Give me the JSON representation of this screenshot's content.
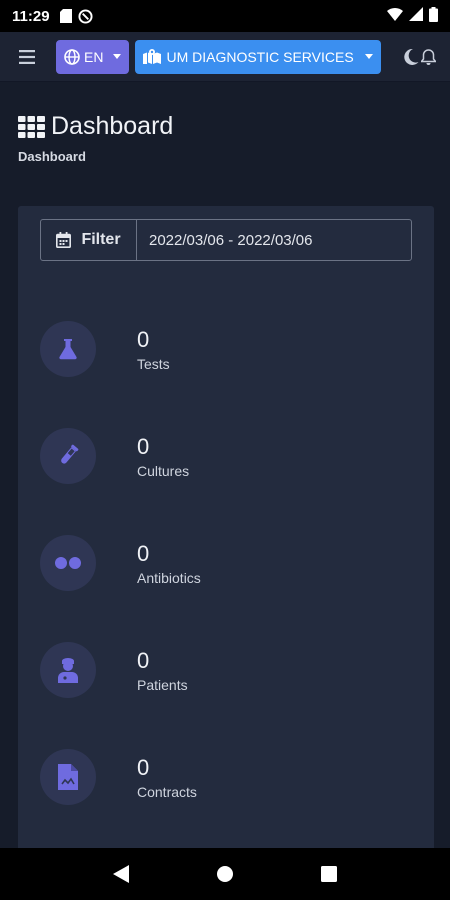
{
  "status_bar": {
    "time": "11:29"
  },
  "navbar": {
    "language_label": "EN",
    "branch_label": "UM DIAGNOSTIC SERVICES"
  },
  "page": {
    "title": "Dashboard",
    "breadcrumb": "Dashboard"
  },
  "filter": {
    "button_label": "Filter",
    "date_range": "2022/03/06 - 2022/03/06"
  },
  "stats": [
    {
      "value": "0",
      "label": "Tests",
      "icon": "flask-icon"
    },
    {
      "value": "0",
      "label": "Cultures",
      "icon": "test-tube-icon"
    },
    {
      "value": "0",
      "label": "Antibiotics",
      "icon": "pills-icon"
    },
    {
      "value": "0",
      "label": "Patients",
      "icon": "user-doctor-icon"
    },
    {
      "value": "0",
      "label": "Contracts",
      "icon": "file-contract-icon"
    }
  ],
  "colors": {
    "accent": "#6f6bdf",
    "branch_button": "#3b8ff0",
    "background": "#161c2a",
    "card": "#232b3e",
    "icon_circle": "#2f3654"
  }
}
